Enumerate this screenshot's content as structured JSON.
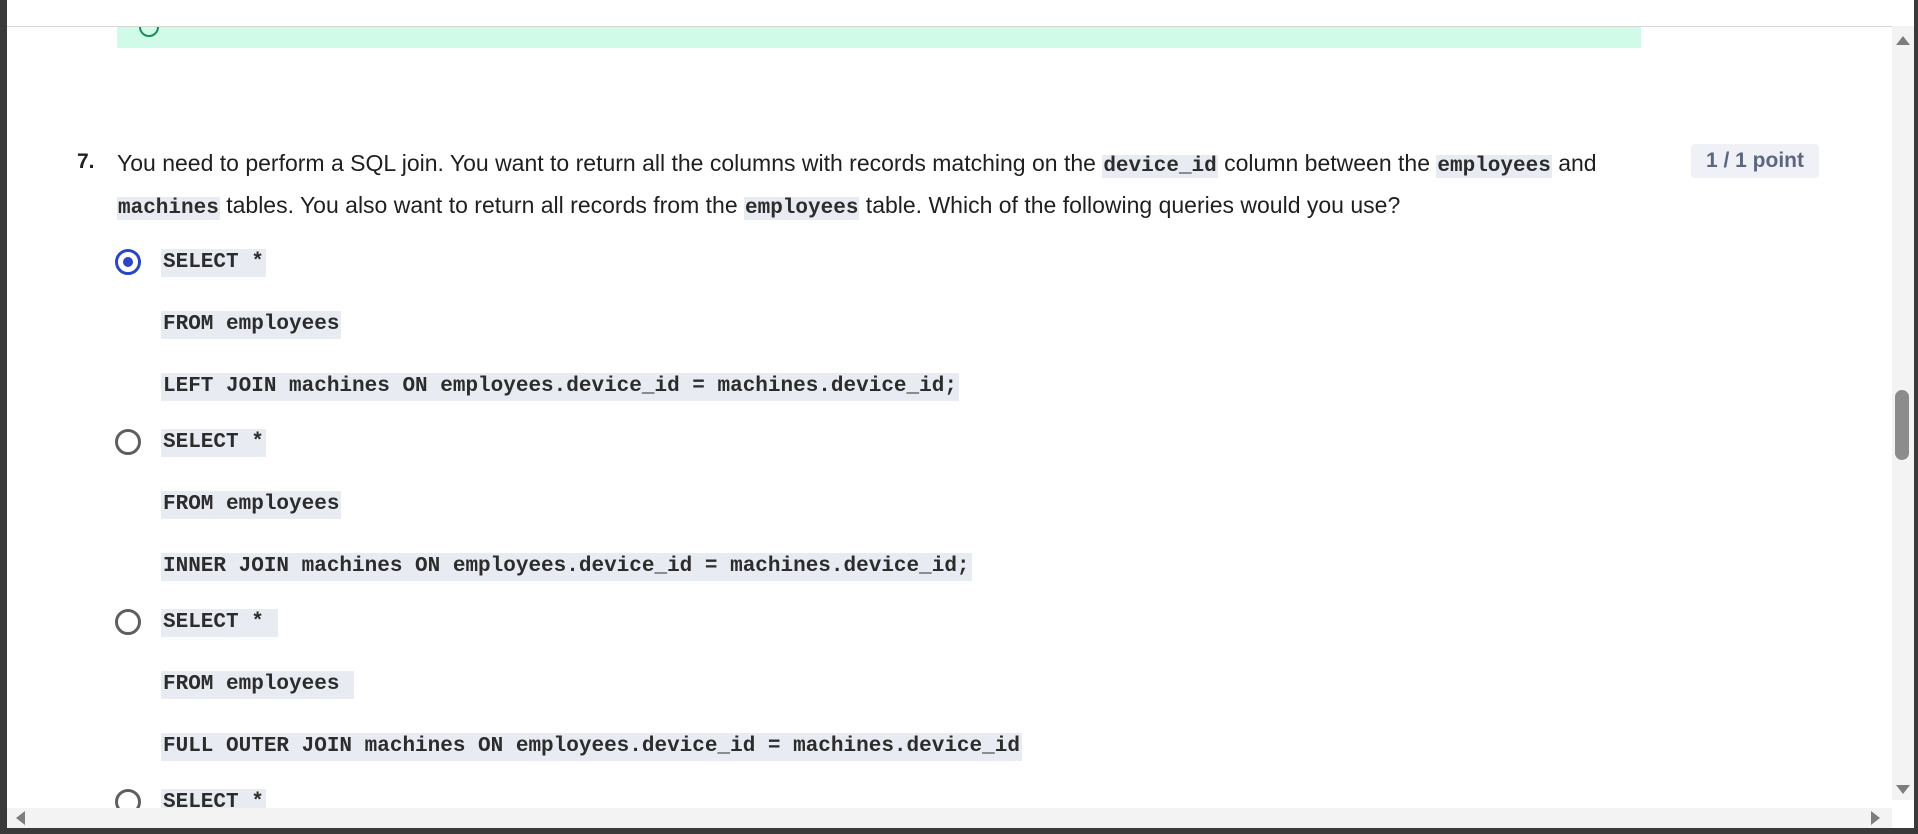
{
  "question": {
    "number": "7.",
    "text_parts": [
      "You need to perform a SQL join. You want to return all the columns with records matching on the ",
      "device_id",
      " column between the ",
      "employees",
      " and ",
      "machines",
      " tables. You also want to return all records from the ",
      "employees",
      " table. Which of the following queries would you use?"
    ],
    "points": "1 / 1 point"
  },
  "options": [
    {
      "selected": true,
      "lines": [
        "SELECT *",
        "FROM employees",
        "LEFT JOIN machines ON employees.device_id = machines.device_id;"
      ]
    },
    {
      "selected": false,
      "lines": [
        "SELECT *",
        "FROM employees",
        "INNER JOIN machines ON employees.device_id = machines.device_id;"
      ]
    },
    {
      "selected": false,
      "lines": [
        "SELECT * ",
        "FROM employees ",
        "FULL OUTER JOIN machines ON employees.device_id = machines.device_id"
      ]
    },
    {
      "selected": false,
      "lines": [
        "SELECT *"
      ]
    }
  ],
  "colors": {
    "selected_radio": "#2946c4",
    "code_background": "#e8ebf2",
    "feedback_background": "#d0fbe8"
  }
}
